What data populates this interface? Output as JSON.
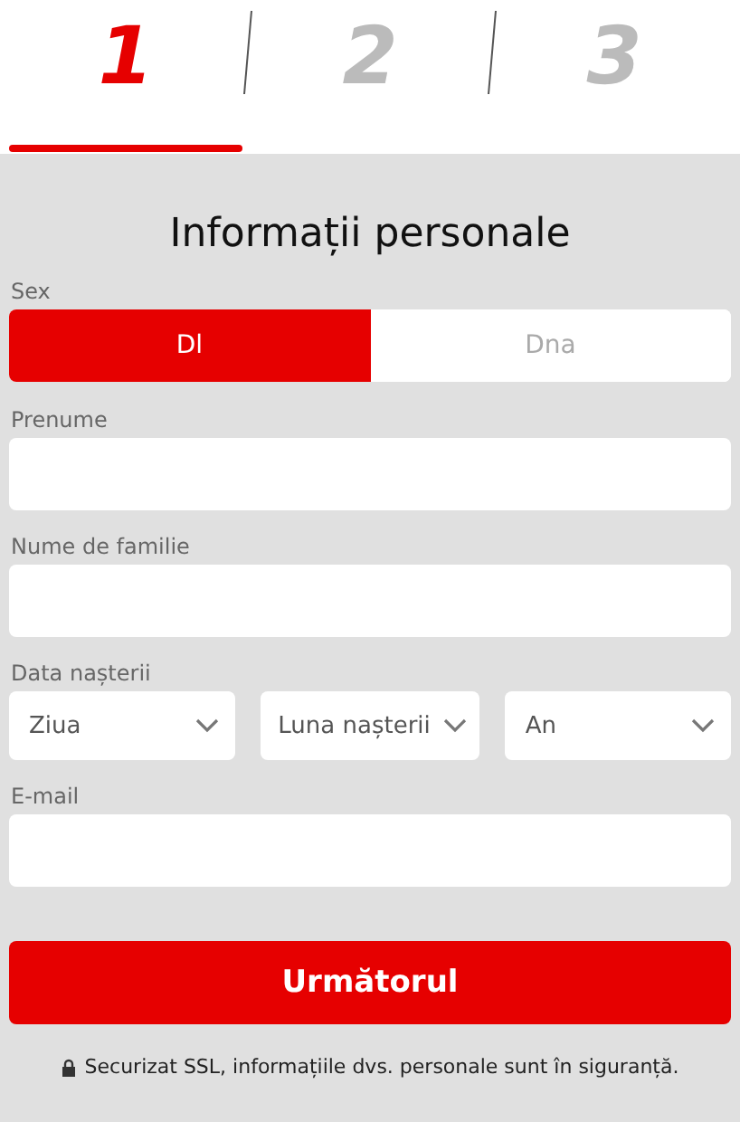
{
  "steps": [
    {
      "label": "1",
      "selected": true
    },
    {
      "label": "2",
      "selected": false
    },
    {
      "label": "3",
      "selected": false
    }
  ],
  "title": "Informații personale",
  "sex": {
    "label": "Sex",
    "options": [
      {
        "label": "Dl",
        "selected": true
      },
      {
        "label": "Dna",
        "selected": false
      }
    ]
  },
  "fields": [
    {
      "label": "Prenume"
    },
    {
      "label": "Nume de familie"
    }
  ],
  "birth_date": {
    "label": "Data nașterii",
    "selects": [
      {
        "value": "Ziua"
      },
      {
        "value": "Luna nașterii"
      },
      {
        "value": "An"
      }
    ]
  },
  "email": {
    "label": "E-mail"
  },
  "next_button": "Următorul",
  "security_note": "Securizat SSL, informațiile dvs. personale sunt în siguranță."
}
